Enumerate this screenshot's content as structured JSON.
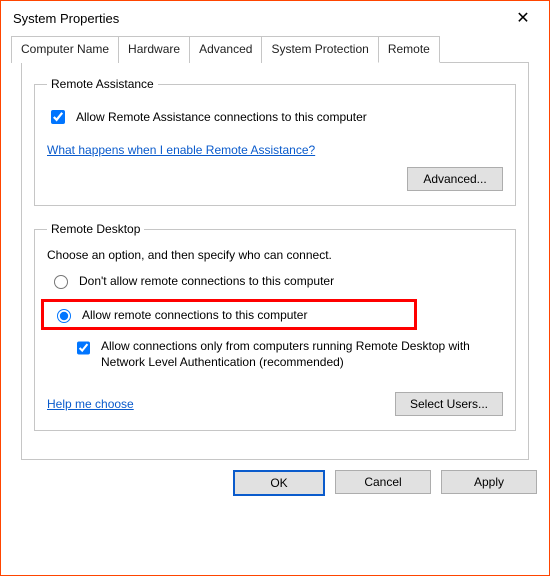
{
  "window": {
    "title": "System Properties"
  },
  "tabs": [
    "Computer Name",
    "Hardware",
    "Advanced",
    "System Protection",
    "Remote"
  ],
  "active_tab_index": 4,
  "remote_assistance": {
    "legend": "Remote Assistance",
    "checkbox_label": "Allow Remote Assistance connections to this computer",
    "checkbox_checked": true,
    "help_link": "What happens when I enable Remote Assistance?",
    "advanced_button": "Advanced..."
  },
  "remote_desktop": {
    "legend": "Remote Desktop",
    "instruction": "Choose an option, and then specify who can connect.",
    "option_deny": "Don't allow remote connections to this computer",
    "option_allow": "Allow remote connections to this computer",
    "selected": "allow",
    "nla_label": "Allow connections only from computers running Remote Desktop with Network Level Authentication (recommended)",
    "nla_checked": true,
    "help_link": "Help me choose",
    "select_users_button": "Select Users..."
  },
  "buttons": {
    "ok": "OK",
    "cancel": "Cancel",
    "apply": "Apply"
  }
}
